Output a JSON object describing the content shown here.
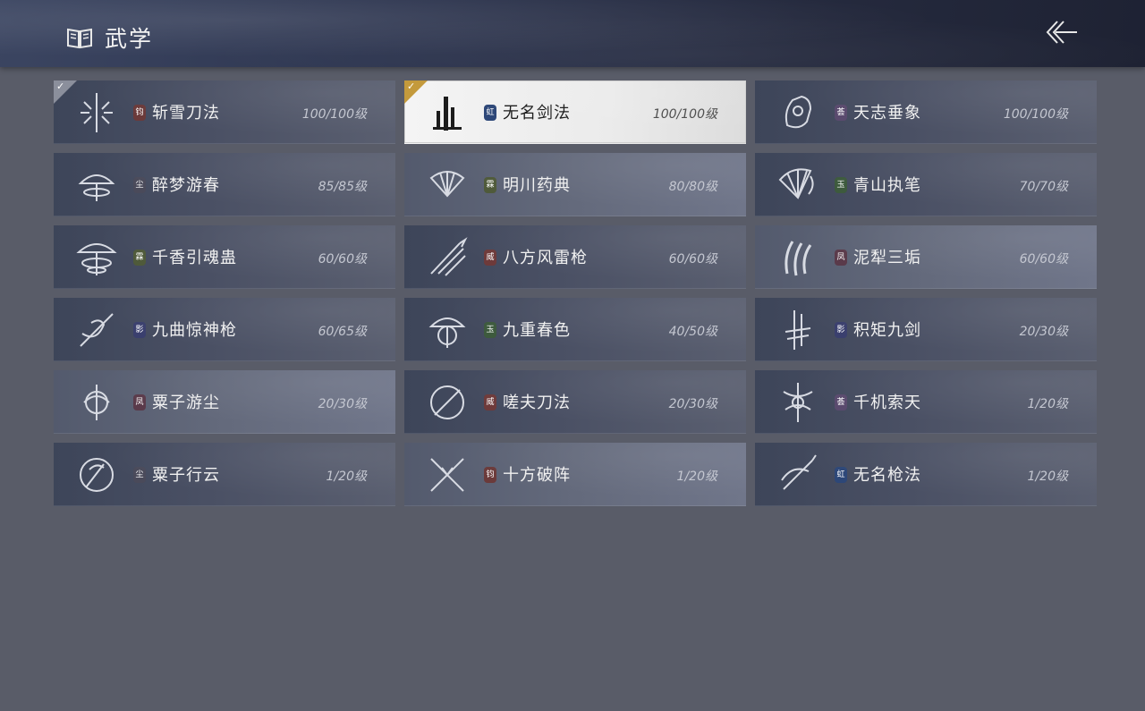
{
  "header": {
    "title": "武学",
    "title_icon": "open-book-icon",
    "back_icon": "back-arrow-icon"
  },
  "colors": {
    "background": "#595c68",
    "card_dark": "#3d4559",
    "card_selected": "#f0f0f0",
    "check_gold": "#c49a3c",
    "check_gray": "#8b8f9c"
  },
  "skills": [
    {
      "name": "斩雪刀法",
      "level": "100/100级",
      "badge": "钧",
      "badge_color": "#6b3a3a",
      "icon": "snowflake-blade-icon",
      "learned": true,
      "selected": false,
      "light": false
    },
    {
      "name": "无名剑法",
      "level": "100/100级",
      "badge": "虹",
      "badge_color": "#2d4778",
      "icon": "calligraphy-sword-icon",
      "learned": true,
      "selected": true,
      "light": false
    },
    {
      "name": "天志垂象",
      "level": "100/100级",
      "badge": "荟",
      "badge_color": "#5a4a6e",
      "icon": "celestial-hand-icon",
      "learned": false,
      "selected": false,
      "light": false
    },
    {
      "name": "醉梦游春",
      "level": "85/85级",
      "badge": "尘",
      "badge_color": "#4a4a5a",
      "icon": "umbrella-icon",
      "learned": false,
      "selected": false,
      "light": false
    },
    {
      "name": "明川药典",
      "level": "80/80级",
      "badge": "霖",
      "badge_color": "#4f5a3a",
      "icon": "fan-icon",
      "learned": false,
      "selected": false,
      "light": true
    },
    {
      "name": "青山执笔",
      "level": "70/70级",
      "badge": "玉",
      "badge_color": "#3d5a3d",
      "icon": "folding-fan-icon",
      "learned": false,
      "selected": false,
      "light": false
    },
    {
      "name": "千香引魂蛊",
      "level": "60/60级",
      "badge": "霖",
      "badge_color": "#4f5a3a",
      "icon": "parasol-icon",
      "learned": false,
      "selected": false,
      "light": false
    },
    {
      "name": "八方风雷枪",
      "level": "60/60级",
      "badge": "威",
      "badge_color": "#6e3a3a",
      "icon": "spear-icon",
      "learned": false,
      "selected": false,
      "light": false
    },
    {
      "name": "泥犁三垢",
      "level": "60/60级",
      "badge": "凤",
      "badge_color": "#5a3a4a",
      "icon": "claw-icon",
      "learned": false,
      "selected": false,
      "light": true
    },
    {
      "name": "九曲惊神枪",
      "level": "60/65级",
      "badge": "影",
      "badge_color": "#3a3f6e",
      "icon": "twisted-spear-icon",
      "learned": false,
      "selected": false,
      "light": false
    },
    {
      "name": "九重春色",
      "level": "40/50级",
      "badge": "玉",
      "badge_color": "#3d5a3d",
      "icon": "umbrella-spin-icon",
      "learned": false,
      "selected": false,
      "light": false
    },
    {
      "name": "积矩九剑",
      "level": "20/30级",
      "badge": "影",
      "badge_color": "#3a3f6e",
      "icon": "twin-swords-icon",
      "learned": false,
      "selected": false,
      "light": false
    },
    {
      "name": "粟子游尘",
      "level": "20/30级",
      "badge": "凤",
      "badge_color": "#5a3a4a",
      "icon": "whirl-icon",
      "learned": false,
      "selected": false,
      "light": true
    },
    {
      "name": "嗟夫刀法",
      "level": "20/30级",
      "badge": "威",
      "badge_color": "#6e3a3a",
      "icon": "circle-blade-icon",
      "learned": false,
      "selected": false,
      "light": false
    },
    {
      "name": "千机索天",
      "level": "1/20级",
      "badge": "荟",
      "badge_color": "#5a4a6e",
      "icon": "chain-dancer-icon",
      "learned": false,
      "selected": false,
      "light": false
    },
    {
      "name": "粟子行云",
      "level": "1/20级",
      "badge": "尘",
      "badge_color": "#4a4a5a",
      "icon": "crescent-blade-icon",
      "learned": false,
      "selected": false,
      "light": false
    },
    {
      "name": "十方破阵",
      "level": "1/20级",
      "badge": "钧",
      "badge_color": "#6b3a3a",
      "icon": "crossed-blades-icon",
      "learned": false,
      "selected": false,
      "light": true
    },
    {
      "name": "无名枪法",
      "level": "1/20级",
      "badge": "虹",
      "badge_color": "#2d4778",
      "icon": "swoosh-spear-icon",
      "learned": false,
      "selected": false,
      "light": false
    }
  ]
}
